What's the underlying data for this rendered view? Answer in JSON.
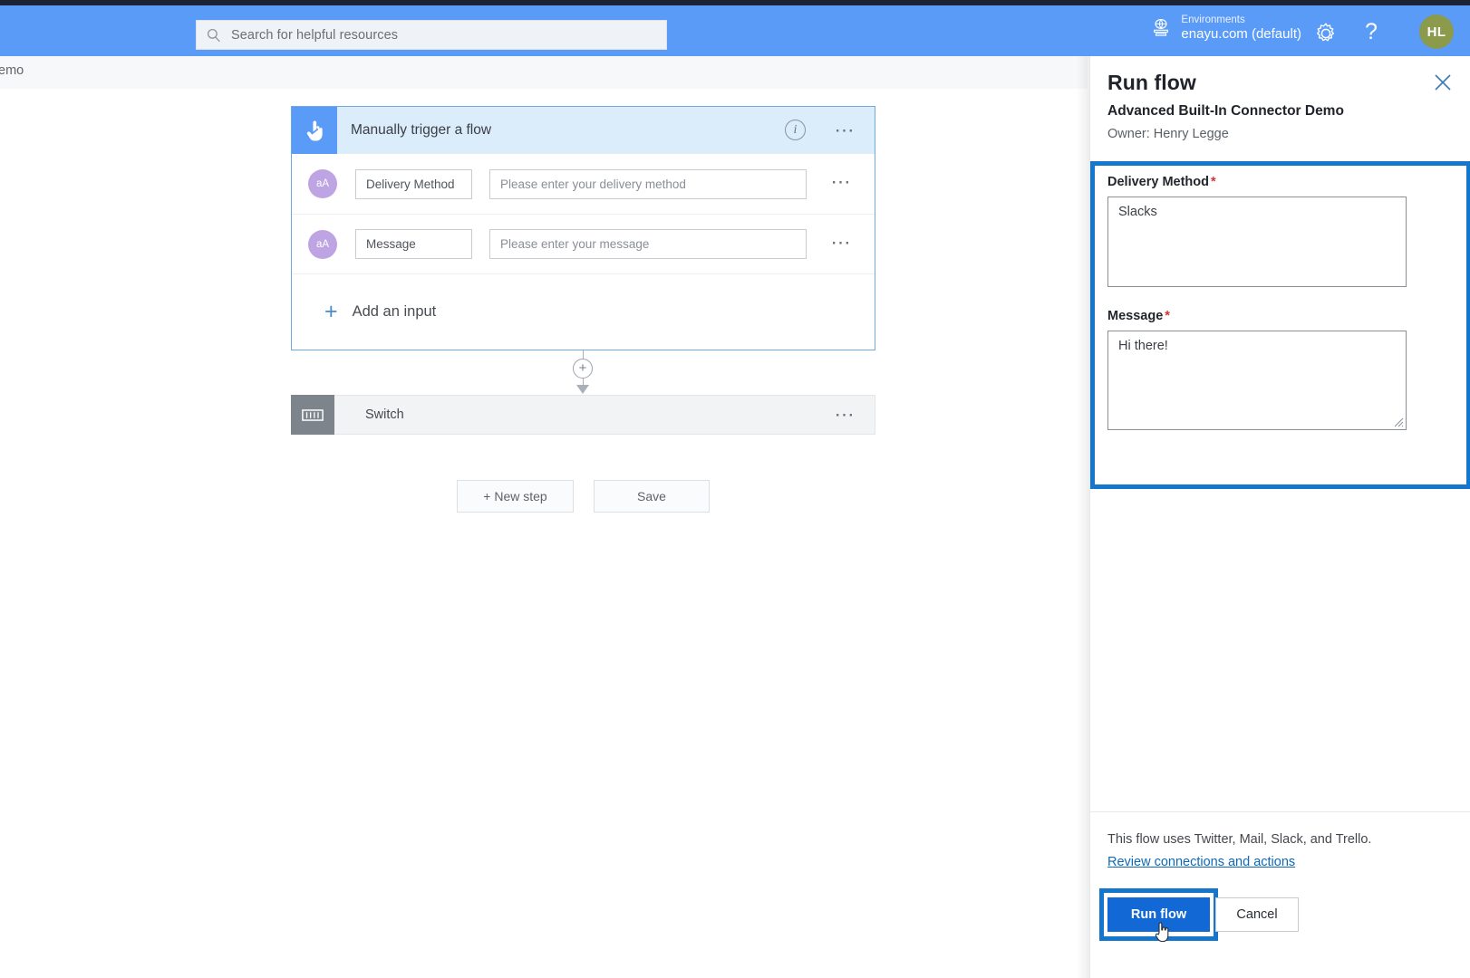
{
  "topbar": {
    "search": {
      "placeholder": "Search for helpful resources",
      "icon": "search-icon"
    },
    "environments": {
      "label": "Environments",
      "value": "enayu.com (default)",
      "icon": "environment-globe-icon"
    },
    "settings_icon": "gear-icon",
    "help_icon": "question-mark-icon",
    "avatar_initials": "HL"
  },
  "breadcrumb": {
    "text": "emo"
  },
  "designer": {
    "trigger": {
      "title": "Manually trigger a flow",
      "icon": "touch-hand-icon",
      "info_icon": "info-circle-icon",
      "menu_icon": "ellipsis-icon",
      "inputs": [
        {
          "avatar": "aA",
          "name": "Delivery Method",
          "placeholder": "Please enter your delivery method",
          "menu_icon": "ellipsis-icon"
        },
        {
          "avatar": "aA",
          "name": "Message",
          "placeholder": "Please enter your message",
          "menu_icon": "ellipsis-icon"
        }
      ],
      "add_input_label": "Add an input",
      "add_input_icon": "plus-icon"
    },
    "connector": {
      "insert_icon": "plus-circle-icon",
      "arrow_icon": "arrow-down-icon"
    },
    "switch_action": {
      "title": "Switch",
      "icon": "switch-case-icon",
      "menu_icon": "ellipsis-icon"
    },
    "new_step_label": "+ New step",
    "save_label": "Save"
  },
  "panel": {
    "title": "Run flow",
    "close_icon": "close-x-icon",
    "flow_name": "Advanced Built-In Connector Demo",
    "owner": "Owner: Henry Legge",
    "fields": [
      {
        "label": "Delivery Method",
        "required": "*",
        "value": "Slacks"
      },
      {
        "label": "Message",
        "required": "*",
        "value": "Hi there!"
      }
    ],
    "connections_note": "This flow uses Twitter, Mail, Slack, and Trello.",
    "review_link": "Review connections and actions",
    "run_label": "Run flow",
    "cancel_label": "Cancel",
    "highlight_color": "#1476cd",
    "primary_color": "#1268d4"
  }
}
